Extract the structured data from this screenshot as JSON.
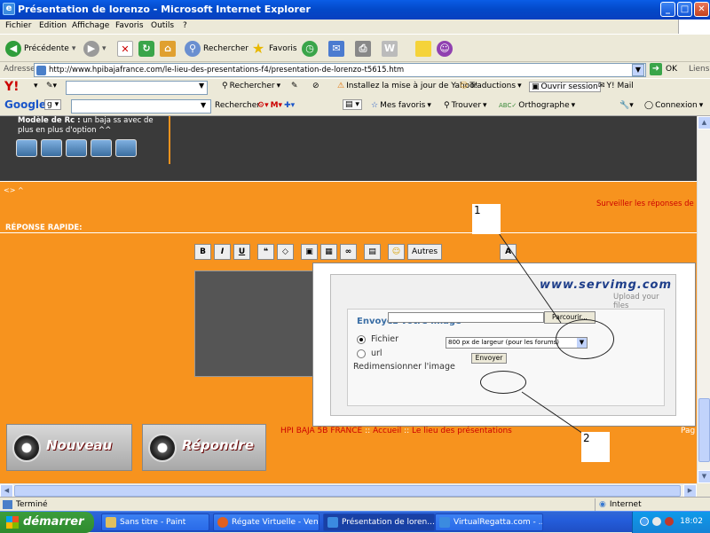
{
  "window": {
    "title": "Présentation de lorenzo - Microsoft Internet Explorer"
  },
  "menu": [
    "Fichier",
    "Edition",
    "Affichage",
    "Favoris",
    "Outils",
    "?"
  ],
  "toolbar": {
    "back": "Précédente",
    "search": "Rechercher",
    "favorites": "Favoris"
  },
  "address": {
    "label": "Adresse",
    "url": "http://www.hpibajafrance.com/le-lieu-des-presentations-f4/presentation-de-lorenzo-t5615.htm",
    "go": "OK",
    "links": "Liens"
  },
  "yahoo": {
    "search": "Rechercher",
    "update": "Installez la mise à jour de Yahoo!",
    "translate": "Traductions",
    "session": "Ouvrir session",
    "mail": "Y! Mail"
  },
  "google": {
    "search": "Rechercher",
    "favorites": "Mes favoris",
    "find": "Trouver",
    "spell": "Orthographe",
    "connect": "Connexion"
  },
  "page": {
    "profile_bold": "Modèle de Rc :",
    "profile_text": " un baja ss avec de plus en plus d'option ^^",
    "arrows": "<> ^",
    "watch": "Surveiller les réponses de",
    "quick_reply": "RÉPONSE RAPIDE:",
    "editor_buttons": [
      "B",
      "I",
      "U",
      "Autres"
    ],
    "upload": {
      "logo": "www.servimg.com",
      "logo_sub": "Upload your files",
      "title": "Envoyez votre image",
      "file_label": "Fichier",
      "url_label": "url",
      "browse": "Parcourir...",
      "resize_label": "Redimensionner l'image",
      "resize_value": "800 px de largeur (pour les forums)",
      "send": "Envoyer"
    },
    "annotations": [
      "1",
      "2"
    ],
    "new_topic": "Nouveau",
    "reply": "Répondre",
    "breadcrumb": [
      "HPI BAJA 5B FRANCE",
      "Accueil",
      "Le lieu des présentations"
    ],
    "breadcrumb_sep": "::",
    "pagination": "Pag"
  },
  "status": {
    "text": "Terminé",
    "zone": "Internet"
  },
  "taskbar": {
    "start": "démarrer",
    "tasks": [
      "Sans titre - Paint",
      "Régate Virtuelle - Ven...",
      "Présentation de loren...",
      "VirtualRegatta.com - ..."
    ],
    "clock": "18:02"
  },
  "colors": {
    "page_bg": "#f7931e",
    "dark_panel": "#3a3a3a",
    "link_red": "#cc0000",
    "xp_blue": "#245ddb"
  }
}
